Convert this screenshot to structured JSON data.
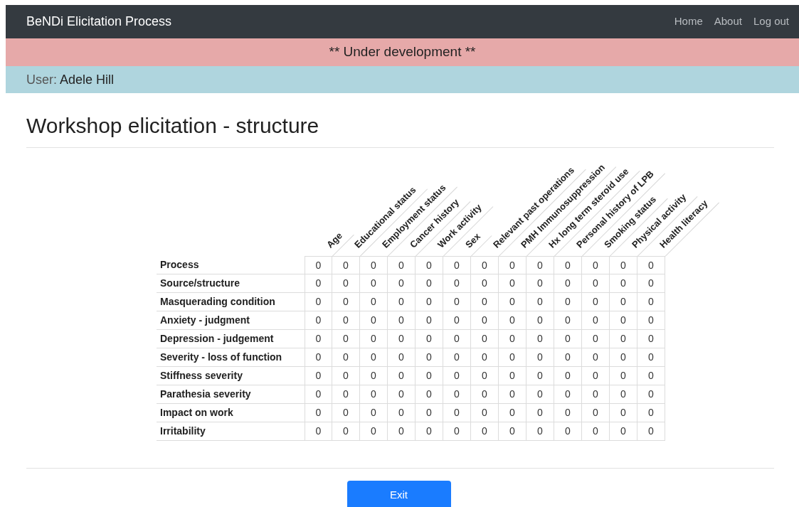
{
  "navbar": {
    "brand": "BeNDi Elicitation Process",
    "links": [
      "Home",
      "About",
      "Log out"
    ]
  },
  "banner": "** Under development **",
  "user": {
    "label": "User:",
    "name": "Adele Hill"
  },
  "title": "Workshop elicitation - structure",
  "table": {
    "columns": [
      "Age",
      "Educational status",
      "Employment status",
      "Cancer history",
      "Work activity",
      "Sex",
      "Relevant past operations",
      "PMH Immunosuppression",
      "Hx long term steroid use",
      "Personal history of LPB",
      "Smoking status",
      "Physical activity",
      "Health literacy"
    ],
    "rows": [
      {
        "label": "Process",
        "values": [
          "0",
          "0",
          "0",
          "0",
          "0",
          "0",
          "0",
          "0",
          "0",
          "0",
          "0",
          "0",
          "0"
        ]
      },
      {
        "label": "Source/structure",
        "values": [
          "0",
          "0",
          "0",
          "0",
          "0",
          "0",
          "0",
          "0",
          "0",
          "0",
          "0",
          "0",
          "0"
        ]
      },
      {
        "label": "Masquerading condition",
        "values": [
          "0",
          "0",
          "0",
          "0",
          "0",
          "0",
          "0",
          "0",
          "0",
          "0",
          "0",
          "0",
          "0"
        ]
      },
      {
        "label": "Anxiety - judgment",
        "values": [
          "0",
          "0",
          "0",
          "0",
          "0",
          "0",
          "0",
          "0",
          "0",
          "0",
          "0",
          "0",
          "0"
        ]
      },
      {
        "label": "Depression - judgement",
        "values": [
          "0",
          "0",
          "0",
          "0",
          "0",
          "0",
          "0",
          "0",
          "0",
          "0",
          "0",
          "0",
          "0"
        ]
      },
      {
        "label": "Severity - loss of function",
        "values": [
          "0",
          "0",
          "0",
          "0",
          "0",
          "0",
          "0",
          "0",
          "0",
          "0",
          "0",
          "0",
          "0"
        ]
      },
      {
        "label": "Stiffness severity",
        "values": [
          "0",
          "0",
          "0",
          "0",
          "0",
          "0",
          "0",
          "0",
          "0",
          "0",
          "0",
          "0",
          "0"
        ]
      },
      {
        "label": "Parathesia severity",
        "values": [
          "0",
          "0",
          "0",
          "0",
          "0",
          "0",
          "0",
          "0",
          "0",
          "0",
          "0",
          "0",
          "0"
        ]
      },
      {
        "label": "Impact on work",
        "values": [
          "0",
          "0",
          "0",
          "0",
          "0",
          "0",
          "0",
          "0",
          "0",
          "0",
          "0",
          "0",
          "0"
        ]
      },
      {
        "label": "Irritability",
        "values": [
          "0",
          "0",
          "0",
          "0",
          "0",
          "0",
          "0",
          "0",
          "0",
          "0",
          "0",
          "0",
          "0"
        ]
      }
    ]
  },
  "exit_button": "Exit"
}
